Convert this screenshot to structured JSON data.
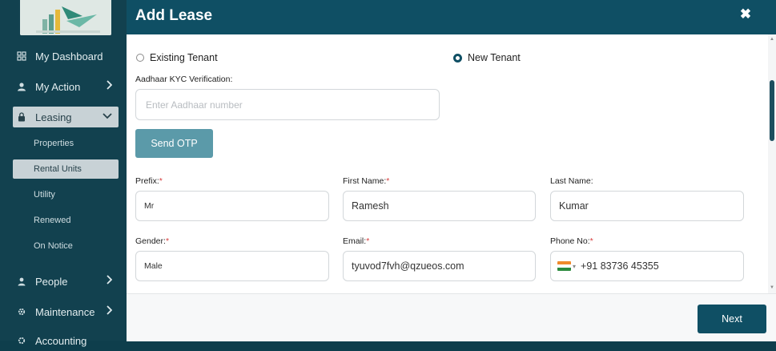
{
  "sidebar": {
    "items": [
      {
        "label": "My Dashboard",
        "icon": "dashboard-icon"
      },
      {
        "label": "My Action",
        "icon": "user-icon"
      },
      {
        "label": "Leasing",
        "icon": "lock-icon"
      },
      {
        "label": "People",
        "icon": "people-icon"
      },
      {
        "label": "Maintenance",
        "icon": "gear-icon"
      },
      {
        "label": "Accounting",
        "icon": "gear-icon"
      }
    ],
    "leasing_sub": [
      {
        "label": "Properties"
      },
      {
        "label": "Rental Units"
      },
      {
        "label": "Utility"
      },
      {
        "label": "Renewed"
      },
      {
        "label": "On Notice"
      }
    ]
  },
  "modal": {
    "title": "Add Lease",
    "close": "✖",
    "radio_existing": "Existing Tenant",
    "radio_new": "New Tenant",
    "aadhaar_label": "Aadhaar KYC Verification:",
    "aadhaar_placeholder": "Enter Aadhaar number",
    "send_otp": "Send OTP",
    "prefix_label": "Prefix:",
    "prefix_value": "Mr",
    "first_name_label": "First Name:",
    "first_name_value": "Ramesh",
    "last_name_label": "Last Name:",
    "last_name_value": "Kumar",
    "gender_label": "Gender:",
    "gender_value": "Male",
    "email_label": "Email:",
    "email_value": "tyuvod7fvh@qzueos.com",
    "phone_label": "Phone No:",
    "phone_value": "+91 83736 45355",
    "next": "Next",
    "required_mark": "*"
  },
  "colors": {
    "header": "#0f4f64",
    "sidebar": "#12414f",
    "otp_button": "#5b9aa9",
    "required": "#d63c3c"
  }
}
